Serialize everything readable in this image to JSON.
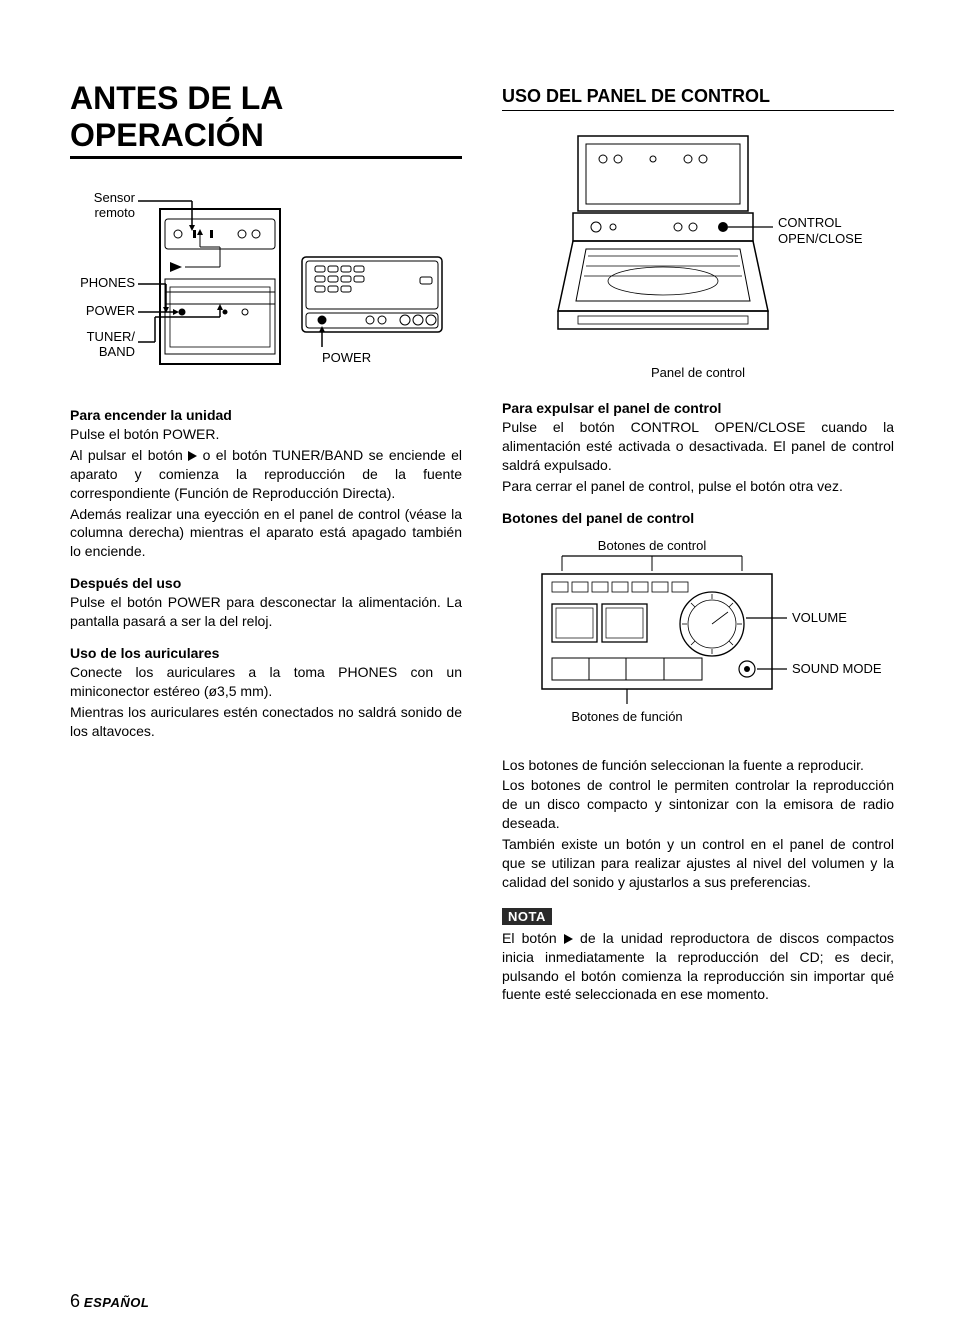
{
  "left": {
    "title": "ANTES DE LA OPERACIÓN",
    "fig1": {
      "sensor_remoto_l1": "Sensor",
      "sensor_remoto_l2": "remoto",
      "phones": "PHONES",
      "power_left": "POWER",
      "tuner_band_l1": "TUNER/",
      "tuner_band_l2": "BAND",
      "power_right": "POWER"
    },
    "s1": {
      "h": "Para encender la unidad",
      "p1": "Pulse el botón POWER.",
      "p2a": "Al pulsar el botón ",
      "p2b": " o el botón TUNER/BAND se enciende el aparato y comienza la reproducción de la fuente correspondiente (Función de Reproducción Directa).",
      "p3": "Además realizar una eyección en el panel de control (véase la columna derecha) mientras el aparato está apagado también lo enciende."
    },
    "s2": {
      "h": "Después del uso",
      "p1": "Pulse el botón POWER para desconectar la alimentación. La pantalla pasará a ser la del reloj."
    },
    "s3": {
      "h": "Uso de los auriculares",
      "p1": "Conecte los auriculares a la toma PHONES con un miniconector estéreo (ø3,5 mm).",
      "p2": "Mientras los auriculares estén conectados no saldrá sonido de los altavoces."
    }
  },
  "right": {
    "title": "USO DEL PANEL DE CONTROL",
    "fig2": {
      "control_open_close_l1": "CONTROL",
      "control_open_close_l2": "OPEN/CLOSE",
      "caption": "Panel de control"
    },
    "s1": {
      "h": "Para expulsar el panel de control",
      "p1": "Pulse el botón CONTROL OPEN/CLOSE cuando la alimentación esté activada o desactivada. El panel de control saldrá expulsado.",
      "p2": "Para cerrar el panel de control, pulse el botón otra vez."
    },
    "s2": {
      "h": "Botones del panel de control",
      "fig_top": "Botones de control",
      "fig_bottom": "Botones de función",
      "volume": "VOLUME",
      "sound_mode": "SOUND MODE"
    },
    "s3": {
      "p1": "Los botones de función seleccionan la fuente a reproducir.",
      "p2": "Los botones de control le permiten controlar la reproducción de un disco compacto y sintonizar con la emisora de radio deseada.",
      "p3": "También existe un botón y un control en el panel de control que se utilizan para realizar ajustes al nivel del volumen y la calidad del sonido y ajustarlos a sus preferencias."
    },
    "nota": {
      "label": "NOTA",
      "p1a": "El botón ",
      "p1b": " de la unidad reproductora de discos compactos inicia inmediatamente la reproducción del CD; es decir, pulsando el botón comienza la reproducción sin importar qué fuente esté seleccionada en ese momento."
    }
  },
  "footer": {
    "page": "6",
    "lang": "ESPAÑOL"
  }
}
